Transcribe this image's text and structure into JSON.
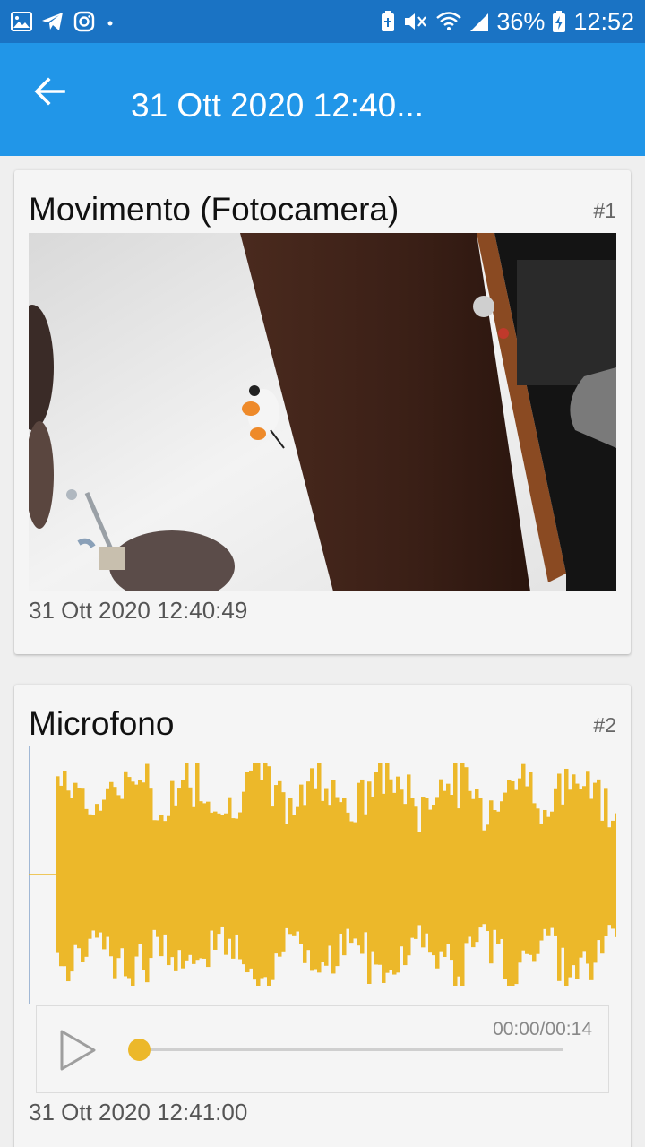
{
  "status_bar": {
    "battery": "36%",
    "time": "12:52",
    "icons": [
      "gallery-icon",
      "telegram-icon",
      "instagram-icon",
      "dot-icon",
      "battery-saver-icon",
      "mute-icon",
      "wifi-icon",
      "signal-icon",
      "battery-charging-icon"
    ]
  },
  "app_bar": {
    "back_icon": "arrow-back-icon",
    "title": "31 Ott 2020 12:40..."
  },
  "cards": [
    {
      "title": "Movimento (Fotocamera)",
      "index": "#1",
      "media": "camera-photo",
      "timestamp": "31 Ott 2020 12:40:49"
    },
    {
      "title": "Microfono",
      "index": "#2",
      "media": "audio-waveform",
      "player": {
        "time": "00:00/00:14",
        "progress": 0,
        "play_icon": "play-icon"
      },
      "timestamp": "31 Ott 2020 12:41:00"
    }
  ],
  "colors": {
    "status_bar": "#1a73c4",
    "app_bar": "#2196e8",
    "waveform": "#ecb82a",
    "card_bg": "#f5f5f5",
    "page_bg": "#efefef"
  }
}
